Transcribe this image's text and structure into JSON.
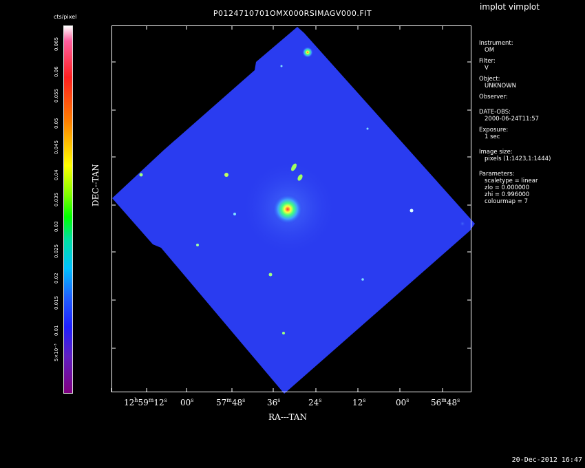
{
  "window": {
    "app_title": "implot vimplot",
    "timestamp": "20-Dec-2012 16:47"
  },
  "plot": {
    "title": "P0124710701OMX000RSIMAGV000.FIT",
    "x_axis_label": "RA---TAN",
    "y_axis_label": "DEC--TAN",
    "ra_ticks": [
      {
        "h": "12",
        "hu": "h",
        "m": "59",
        "mu": "m",
        "s": "12",
        "su": "s"
      },
      {
        "s": "00",
        "su": "s"
      },
      {
        "m": "57",
        "mu": "m",
        "s": "48",
        "su": "s"
      },
      {
        "s": "36",
        "su": "s"
      },
      {
        "s": "24",
        "su": "s"
      },
      {
        "s": "12",
        "su": "s"
      },
      {
        "s": "00",
        "su": "s"
      },
      {
        "m": "56",
        "mu": "m",
        "s": "48",
        "su": "s"
      }
    ]
  },
  "colorbar": {
    "label": "cts/pixel",
    "ticks": [
      "0.065",
      "0.06",
      "0.055",
      "0.05",
      "0.045",
      "0.04",
      "0.035",
      "0.03",
      "0.025",
      "0.02",
      "0.015",
      "0.01",
      "5×10⁻³"
    ],
    "colors": {
      "top": "#ffffff",
      "high": "#ff2020",
      "upper": "#ffff00",
      "mid": "#00ff00",
      "lower": "#00c0ff",
      "low": "#2020ff",
      "bottom": "#800080"
    }
  },
  "info_panel": {
    "instrument_label": "Instrument:",
    "instrument": "OM",
    "filter_label": "Filter:",
    "filter": "V",
    "object_label": "Object:",
    "object": "UNKNOWN",
    "observer_label": "Observer:",
    "date_label": "DATE-OBS:",
    "date": "2000-06-24T11:57",
    "exposure_label": "Exposure:",
    "exposure": "1 sec",
    "image_size_label": "Image size:",
    "image_size": "pixels (1:1423,1:1444)",
    "parameters_label": "Parameters:",
    "scaletype": "scaletype = linear",
    "zlo": "zlo = 0.000000",
    "zhi": "zhi = 0.996000",
    "colourmap": "colourmap =    7"
  },
  "image": {
    "background_color": "#2a3cf0",
    "sky_color": "#000000",
    "central_object_color": "#ff4040"
  }
}
